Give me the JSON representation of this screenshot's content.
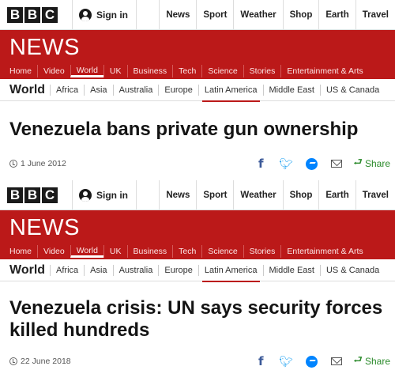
{
  "header": {
    "bbc_letters": [
      "B",
      "B",
      "C"
    ],
    "signin_label": "Sign in",
    "topnav": [
      "News",
      "Sport",
      "Weather",
      "Shop",
      "Earth",
      "Travel"
    ]
  },
  "newsbar": {
    "wordmark": "NEWS",
    "sections": [
      "Home",
      "Video",
      "World",
      "UK",
      "Business",
      "Tech",
      "Science",
      "Stories",
      "Entertainment & Arts"
    ],
    "active_section": "World"
  },
  "worldbar": {
    "heading": "World",
    "regions": [
      "Africa",
      "Asia",
      "Australia",
      "Europe",
      "Latin America",
      "Middle East",
      "US & Canada"
    ],
    "active_region": "Latin America"
  },
  "articles": [
    {
      "headline": "Venezuela bans private gun ownership",
      "date": "1 June 2012"
    },
    {
      "headline": "Venezuela crisis: UN says security forces killed hundreds",
      "date": "22 June 2018"
    }
  ],
  "share": {
    "label": "Share"
  },
  "colors": {
    "brand_red": "#bb1919",
    "facebook": "#3b5998",
    "twitter": "#1da1f2",
    "messenger": "#0084ff",
    "share_green": "#2a8a2a"
  }
}
